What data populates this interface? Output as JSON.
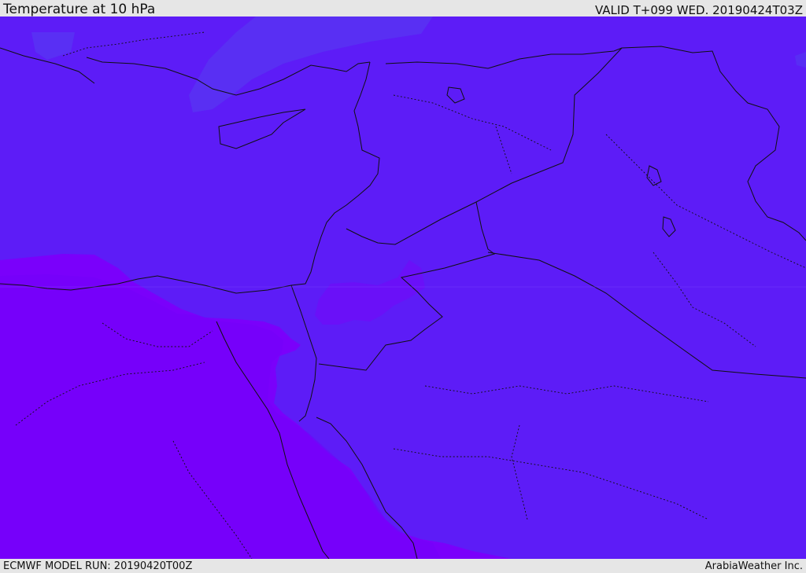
{
  "header": {
    "title": "Temperature at 10 hPa",
    "valid": "VALID T+099 WED. 20190424T03Z"
  },
  "footer": {
    "model_run": "ECMWF MODEL RUN: 20190420T00Z",
    "credit": "ArabiaWeather Inc."
  },
  "map": {
    "field": "temperature",
    "level": "10 hPa",
    "colors": {
      "cool_band": "#5d1cf7",
      "pale_streak": "#5a34f4",
      "warm_band": "#7a00fb",
      "borders": "#101010"
    }
  }
}
